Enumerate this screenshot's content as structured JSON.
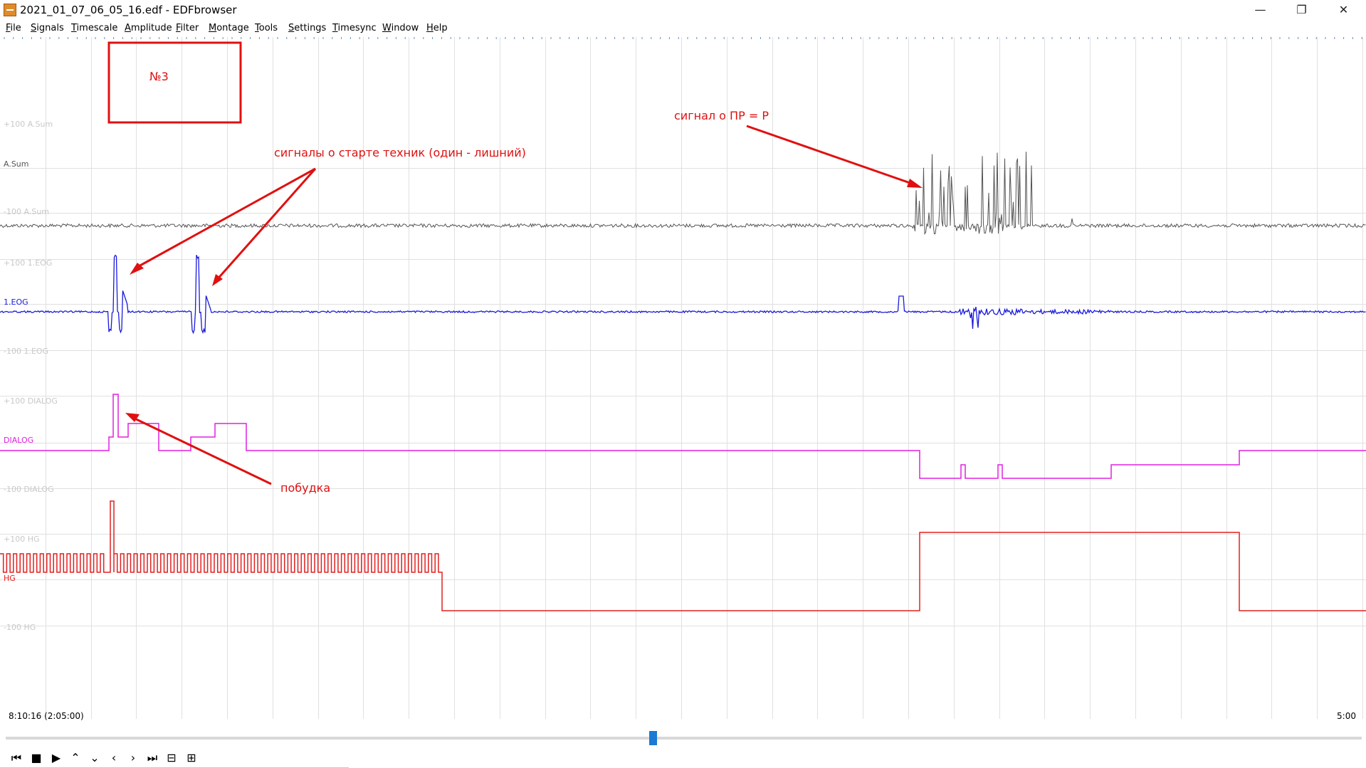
{
  "window": {
    "title": "2021_01_07_06_05_16.edf - EDFbrowser",
    "app_icon": "edfbrowser-icon",
    "controls": [
      "minimize-icon",
      "maximize-icon",
      "close-icon"
    ],
    "minimize_glyph": "—",
    "maximize_glyph": "❐",
    "close_glyph": "✕"
  },
  "menu": {
    "items": [
      {
        "u": "F",
        "rest": "ile"
      },
      {
        "u": "S",
        "rest": "ignals"
      },
      {
        "u": "T",
        "rest": "imescale"
      },
      {
        "u": "A",
        "rest": "mplitude"
      },
      {
        "u": "F",
        "rest": "ilter"
      },
      {
        "u": "M",
        "rest": "ontage"
      },
      {
        "u": "T",
        "rest": "ools"
      },
      {
        "u": "S",
        "rest": "ettings"
      },
      {
        "u": "T",
        "rest": "imesync"
      },
      {
        "u": "W",
        "rest": "indow"
      },
      {
        "u": "H",
        "rest": "elp"
      }
    ]
  },
  "signals": [
    {
      "label": "A.Sum",
      "upper": "+100 A.Sum",
      "lower": "-100 A.Sum",
      "color": "#555555"
    },
    {
      "label": "1.EOG",
      "upper": "+100 1.EOG",
      "lower": "-100 1.EOG",
      "color": "#1a1adc"
    },
    {
      "label": "DIALOG",
      "upper": "+100 DIALOG",
      "lower": "-100 DIALOG",
      "color": "#e020e0"
    },
    {
      "label": "HG",
      "upper": "+100 HG",
      "lower": "-100 HG",
      "color": "#e02020"
    }
  ],
  "annotations": {
    "box_label": "№3",
    "start_signals": "сигналы о старте техник (один - лишний)",
    "pr_signal": "сигнал о ПР = Р",
    "wakeup": "побудка",
    "color": "#e01010"
  },
  "timeline": {
    "start_time": "8:10:16 (2:05:00)",
    "end_time": "5:00",
    "scroll_position": 0.478
  },
  "playback": {
    "buttons": [
      {
        "name": "go-to-start-button",
        "glyph": "⏮"
      },
      {
        "name": "stop-button",
        "glyph": "■"
      },
      {
        "name": "play-button",
        "glyph": "▶"
      },
      {
        "name": "scroll-up-button",
        "glyph": "⌃"
      },
      {
        "name": "scroll-down-button",
        "glyph": "⌄"
      },
      {
        "name": "step-back-button",
        "glyph": "‹"
      },
      {
        "name": "step-forward-button",
        "glyph": "›"
      },
      {
        "name": "go-to-end-button",
        "glyph": "⏭"
      },
      {
        "name": "zoom-out-button",
        "glyph": "⊟"
      },
      {
        "name": "zoom-in-button",
        "glyph": "⊞"
      }
    ]
  }
}
